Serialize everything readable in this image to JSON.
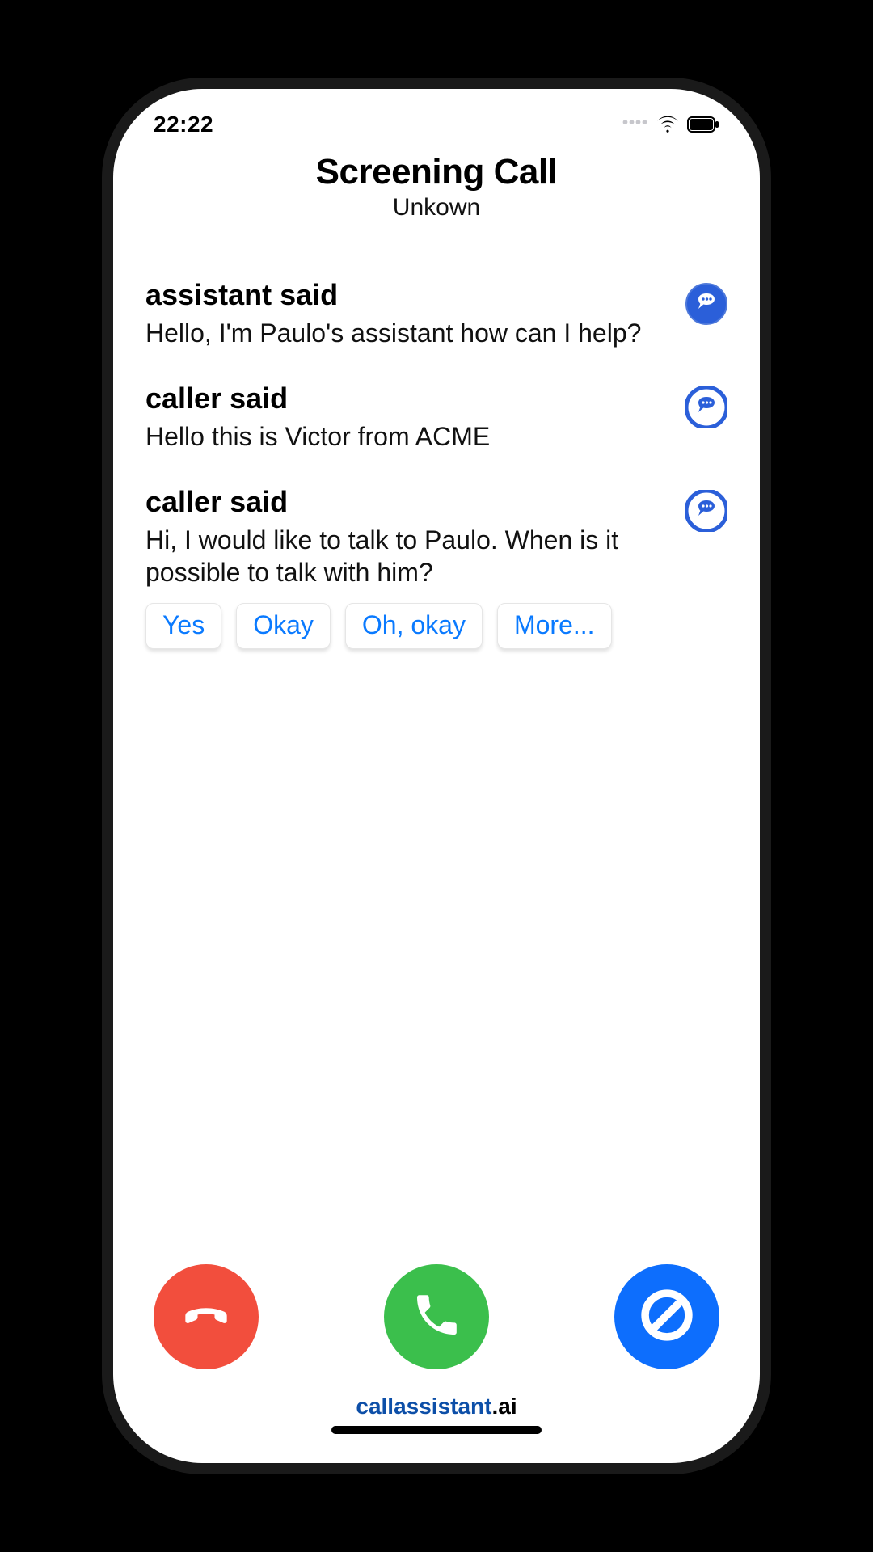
{
  "status_bar": {
    "time": "22:22",
    "signal_dots": "••••"
  },
  "header": {
    "title": "Screening Call",
    "subtitle": "Unkown"
  },
  "messages": [
    {
      "speaker": "assistant said",
      "text": "Hello, I'm Paulo's assistant how can I help?"
    },
    {
      "speaker": "caller said",
      "text": "Hello this is Victor from ACME"
    },
    {
      "speaker": "caller said",
      "text": "Hi, I would like to talk to Paulo. When is it possible to talk with him?"
    }
  ],
  "quick_replies": [
    "Yes",
    "Okay",
    "Oh, okay",
    "More..."
  ],
  "icons": {
    "speech": "speech-bubble-icon",
    "decline": "phone-hangup-icon",
    "accept": "phone-icon",
    "block": "block-icon"
  },
  "colors": {
    "accent_blue": "#0d6efd",
    "link_blue": "#0a7aff",
    "decline_red": "#f24e3d",
    "accept_green": "#3bbf4c"
  },
  "footer": {
    "brand_primary": "callassistant",
    "brand_suffix": ".ai"
  }
}
